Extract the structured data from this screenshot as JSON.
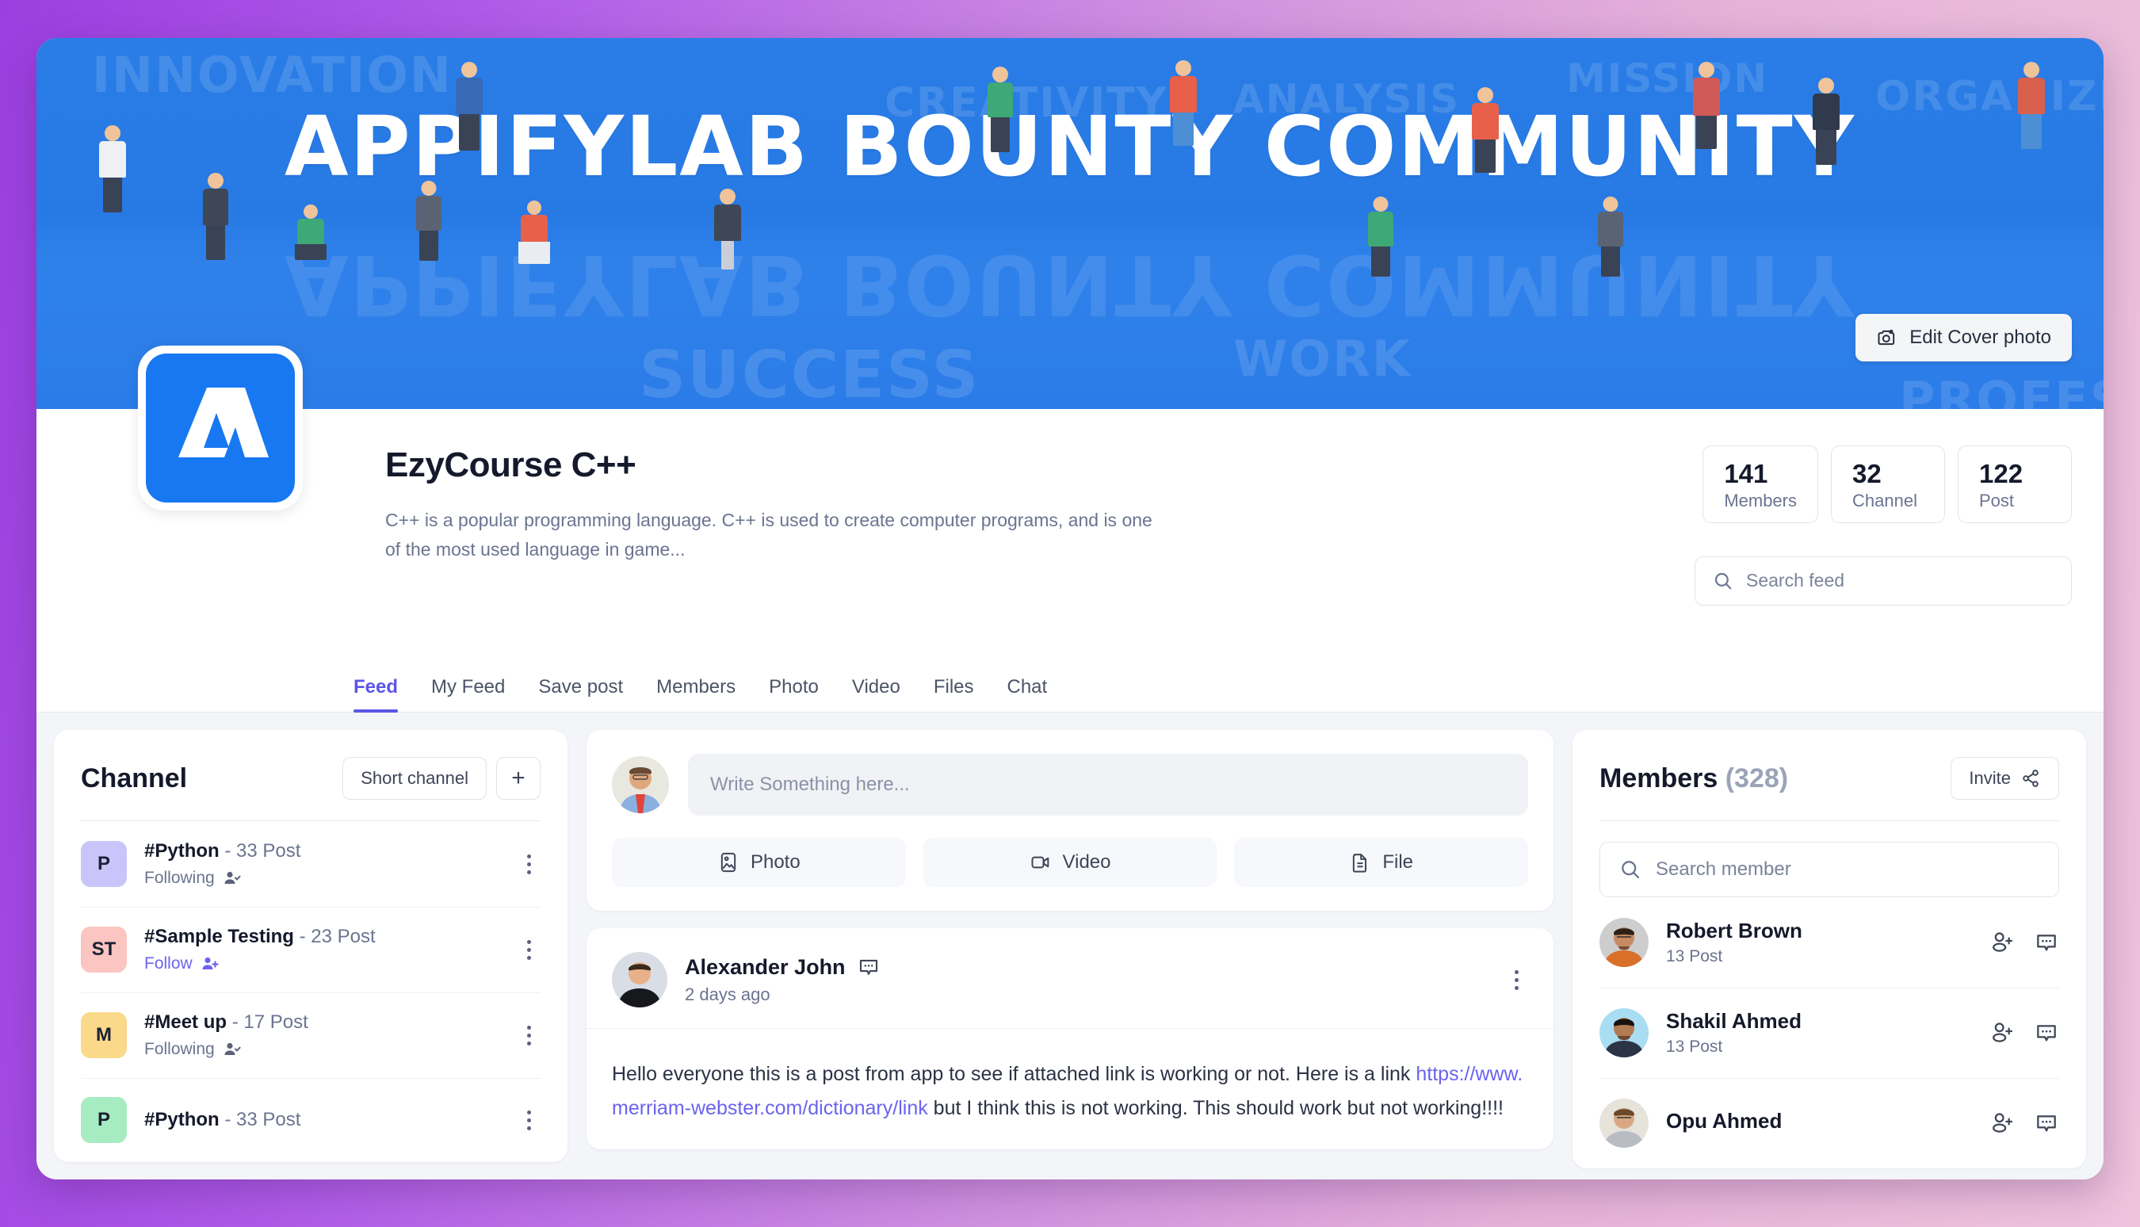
{
  "cover": {
    "title": "APPIFYLAB BOUNTY COMMUNITY",
    "bg_words": [
      "INNOVATION",
      "CREATIVITY",
      "ANALYSIS",
      "MISSION",
      "ORGANIZE",
      "SUCCESS",
      "WORK",
      "PROFESSIONAL"
    ],
    "edit_button": "Edit Cover photo",
    "colors": {
      "banner_blue": "#2779e4",
      "button_bg": "#f4f5f7"
    }
  },
  "profile": {
    "name": "EzyCourse C++",
    "description": "C++ is a popular programming language. C++ is used to create computer programs, and is one of the most used language in game...",
    "stats": [
      {
        "value": "141",
        "label": "Members"
      },
      {
        "value": "32",
        "label": "Channel"
      },
      {
        "value": "122",
        "label": "Post"
      }
    ],
    "search": {
      "placeholder": "Search feed",
      "value": ""
    }
  },
  "tabs": [
    {
      "label": "Feed",
      "active": true
    },
    {
      "label": "My Feed",
      "active": false
    },
    {
      "label": "Save post",
      "active": false
    },
    {
      "label": "Members",
      "active": false
    },
    {
      "label": "Photo",
      "active": false
    },
    {
      "label": "Video",
      "active": false
    },
    {
      "label": "Files",
      "active": false
    },
    {
      "label": "Chat",
      "active": false
    }
  ],
  "channel_panel": {
    "title": "Channel",
    "sort_button": "Short channel",
    "add_button": "+",
    "items": [
      {
        "initials": "P",
        "name": "#Python",
        "separator": "-",
        "posts": "33 Post",
        "follow_state": "Following",
        "badge_color": "#c9c4fa"
      },
      {
        "initials": "ST",
        "name": "#Sample Testing",
        "separator": "-",
        "posts": "23 Post",
        "follow_state": "Follow",
        "badge_color": "#fbc5c2"
      },
      {
        "initials": "M",
        "name": "#Meet up",
        "separator": "-",
        "posts": "17 Post",
        "follow_state": "Following",
        "badge_color": "#fbd98a"
      },
      {
        "initials": "P",
        "name": "#Python",
        "separator": "-",
        "posts": "33 Post",
        "follow_state": "",
        "badge_color": "#a6ecc0"
      }
    ]
  },
  "composer": {
    "placeholder": "Write Something here...",
    "value": "",
    "buttons": [
      {
        "label": "Photo",
        "icon": "photo-icon"
      },
      {
        "label": "Video",
        "icon": "video-icon"
      },
      {
        "label": "File",
        "icon": "file-icon"
      }
    ]
  },
  "post": {
    "author": "Alexander John",
    "timestamp": "2 days ago",
    "text_before": "Hello everyone   this is a post from app to see if attached link is working or not. Here is a link ",
    "link_text": "https://www.merriam-webster.com/dictionary/link",
    "text_after": "  but I think this is not working. This should work but not working!!!!"
  },
  "members_panel": {
    "title": "Members",
    "count": "(328)",
    "invite_button": "Invite",
    "search": {
      "placeholder": "Search member",
      "value": ""
    },
    "items": [
      {
        "name": "Robert Brown",
        "posts": "13 Post",
        "avatar_bg": "#cdcdcd",
        "shirt": "#d8702a",
        "skin": "#c68a63",
        "hair": "#2e2117"
      },
      {
        "name": "Shakil Ahmed",
        "posts": "13 Post",
        "avatar_bg": "#a9ddf2",
        "shirt": "#2b3446",
        "skin": "#b07a52",
        "hair": "#17120d"
      },
      {
        "name": "Opu Ahmed",
        "posts": "",
        "avatar_bg": "#e6e3da",
        "shirt": "#b9bcc2",
        "skin": "#d9a883",
        "hair": "#6b4a2c"
      }
    ]
  },
  "theme": {
    "accent": "#5b55e8",
    "frame_gradient_start": "#9b3fe0",
    "frame_gradient_end": "#eec3dc",
    "page_bg": "#f3f5f9"
  }
}
